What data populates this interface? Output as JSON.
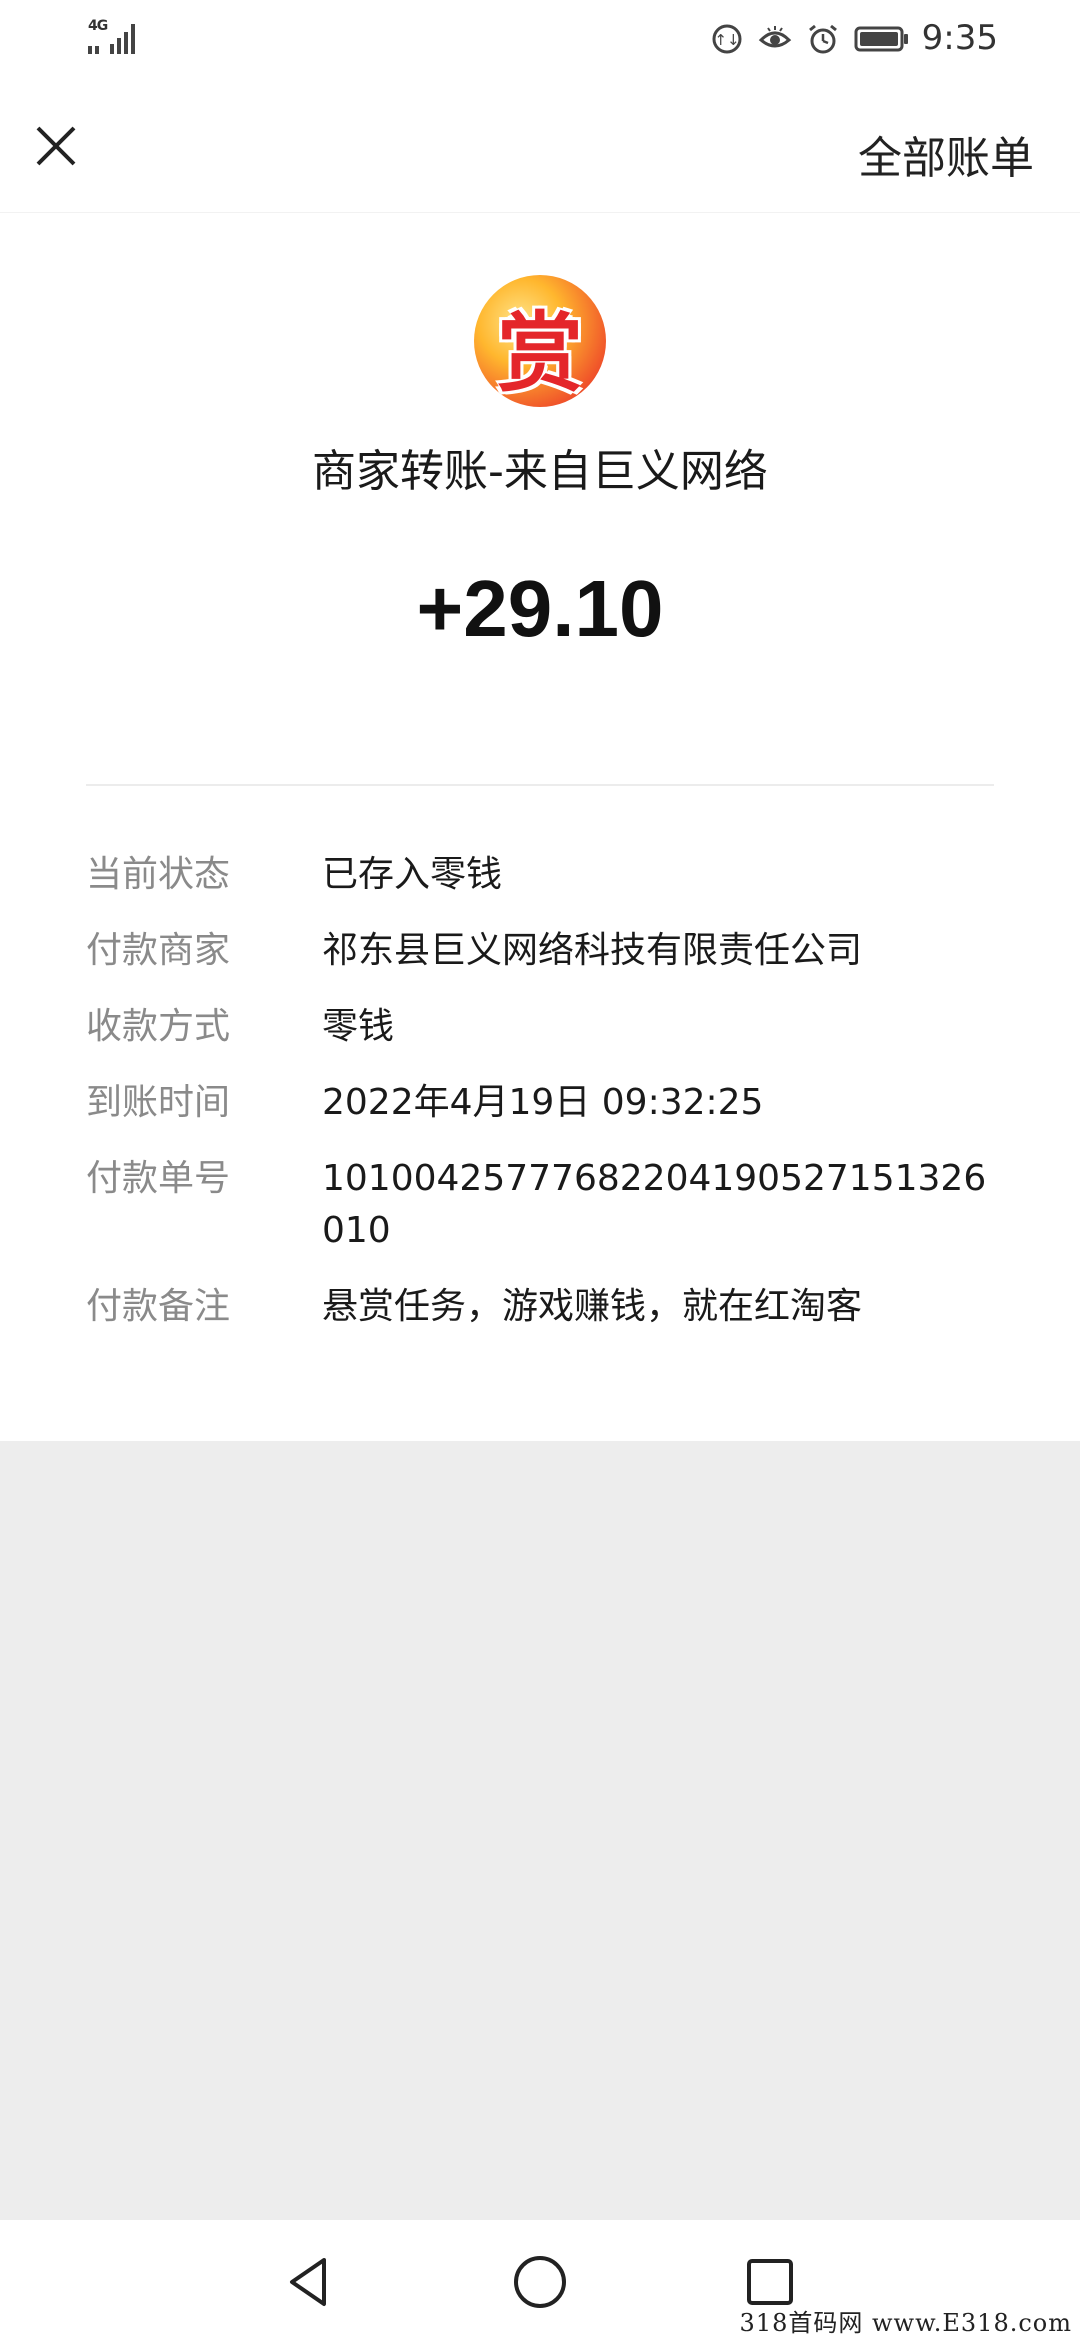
{
  "status_bar": {
    "network": "4G",
    "time": "9:35",
    "icons": [
      "signal-icon",
      "data-saver-icon",
      "eye-comfort-icon",
      "alarm-icon",
      "battery-icon"
    ]
  },
  "top_bar": {
    "close_icon": "close-icon",
    "all_bills_label": "全部账单"
  },
  "transaction": {
    "avatar_char": "赏",
    "title": "商家转账-来自巨义网络",
    "amount": "+29.10"
  },
  "details": [
    {
      "label": "当前状态",
      "value": "已存入零钱"
    },
    {
      "label": "付款商家",
      "value": "祁东县巨义网络科技有限责任公司"
    },
    {
      "label": "收款方式",
      "value": "零钱"
    },
    {
      "label": "到账时间",
      "value": "2022年4月19日 09:32:25"
    },
    {
      "label": "付款单号",
      "value": "10100425777682204190527151326010"
    },
    {
      "label": "付款备注",
      "value": "悬赏任务，游戏赚钱，就在红淘客"
    }
  ],
  "nav_bar": {
    "icons": [
      "back-triangle-icon",
      "home-circle-icon",
      "recents-square-icon"
    ]
  },
  "watermark": "318首码网  www.E318.com"
}
